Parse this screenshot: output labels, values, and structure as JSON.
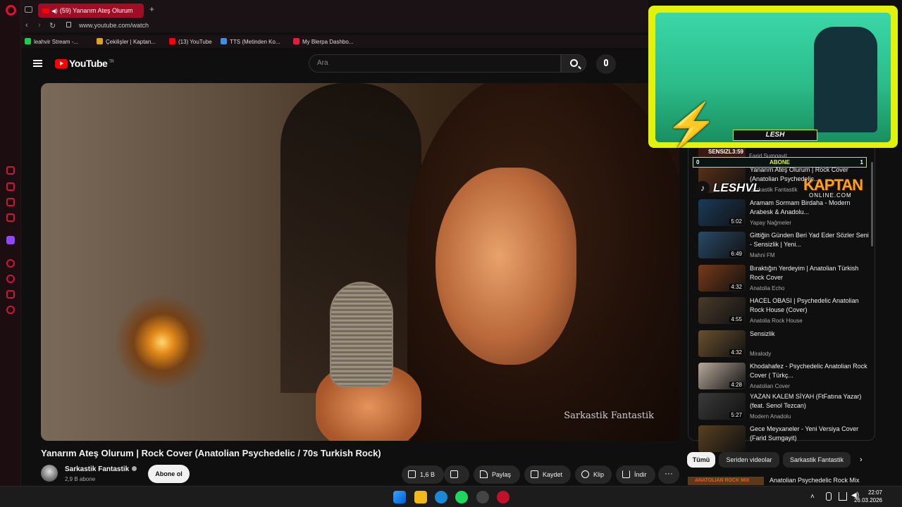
{
  "browser": {
    "tab_title": "(59) Yanarım Ateş Olurum",
    "url": "www.youtube.com/watch",
    "bookmarks": [
      {
        "label": "leahvir Stream -...",
        "color": "#1ccf4a"
      },
      {
        "label": "Çekilişler | Kaptan...",
        "color": "#e0a21a"
      },
      {
        "label": "(13) YouTube",
        "color": "#ff0000"
      },
      {
        "label": "TTS (Metinden Ko...",
        "color": "#3a8fe8"
      },
      {
        "label": "My Blerpa Dashbo...",
        "color": "#e0203a"
      }
    ]
  },
  "youtube": {
    "logo": "YouTube",
    "country": "TR",
    "search_placeholder": "Ara"
  },
  "video": {
    "watermark": "Sarkastik  Fantastik",
    "title": "Yanarım Ateş Olurum | Rock Cover (Anatolian Psychedelic / 70s Turkish Rock)",
    "channel": "Sarkastik Fantastik",
    "subscribers": "2,9 B abone",
    "subscribe_label": "Abone ol",
    "actions": {
      "likes": "1,6 B",
      "share": "Paylaş",
      "save": "Kaydet",
      "clip": "Klip",
      "download": "İndir"
    }
  },
  "recommendations": [
    {
      "title": "Yanarım Ateş Olurum | Rock Cover (Anatolian Psychedelic...",
      "channel": "Sarkastik Fantastik",
      "duration": "",
      "color": "#5a3018"
    },
    {
      "title": "Aramam Sormam Birdaha - Modern Arabesk & Anadolu...",
      "channel": "Yapay Nağmeler",
      "duration": "5:02",
      "color": "#1a3a5a"
    },
    {
      "title": "Gittiğin Günden Beri Yad Eder Sözler Seni - Sensizlik | Yeni...",
      "channel": "Mahni FM",
      "duration": "6:49",
      "color": "#2a4a6a"
    },
    {
      "title": "Bıraktığın Yerdeyim | Anatolian Türkish Rock Cover",
      "channel": "Anatolia Echo",
      "duration": "4:32",
      "color": "#7a3a18"
    },
    {
      "title": "HACEL OBASI | Psychedelic Anatolian Rock House (Cover)",
      "channel": "Anatolia Rock House",
      "duration": "4:55",
      "color": "#4a3a2a"
    },
    {
      "title": "Sensizlik",
      "channel": "Miralody",
      "duration": "4:32",
      "color": "#6a5030"
    },
    {
      "title": "Khodahafez - Psychedelic Anatolian Rock Cover ( Türkç...",
      "channel": "Anatolian Cover",
      "duration": "4:28",
      "color": "#b8a89a"
    },
    {
      "title": "YAZAN KALEM SİYAH (FtFatına Yazar) (feat. Senol Tezcan)",
      "channel": "Modern Anadolu",
      "duration": "5:27",
      "color": "#3a3a3a"
    },
    {
      "title": "Gece Meyxaneler - Yeni Versiya Cover (Farid Sumgayit)",
      "channel": "",
      "duration": "",
      "color": "#5a4020"
    }
  ],
  "rec_partial": {
    "thumb_text": "SENSIZL",
    "duration": "3:59",
    "channel": "Farid Sumgayit"
  },
  "chips": {
    "all": "Tümü",
    "series": "Seriden videolar",
    "channel": "Sarkastik Fantastik"
  },
  "bottom_rec": {
    "thumb_text": "ANATOLIAN ROCK MIX",
    "title": "Anatolian Psychedelic Rock Mix"
  },
  "overlay": {
    "abone_label": "ABONE",
    "abone_left": "0",
    "abone_right": "1",
    "tiktok_name": "LESHVL",
    "kaptan": "KAPTAN",
    "kaptan_sub": "ONLINE.COM",
    "cam_name": "LESH"
  },
  "clock": {
    "time": "22:07",
    "date": "26.03.2026"
  }
}
